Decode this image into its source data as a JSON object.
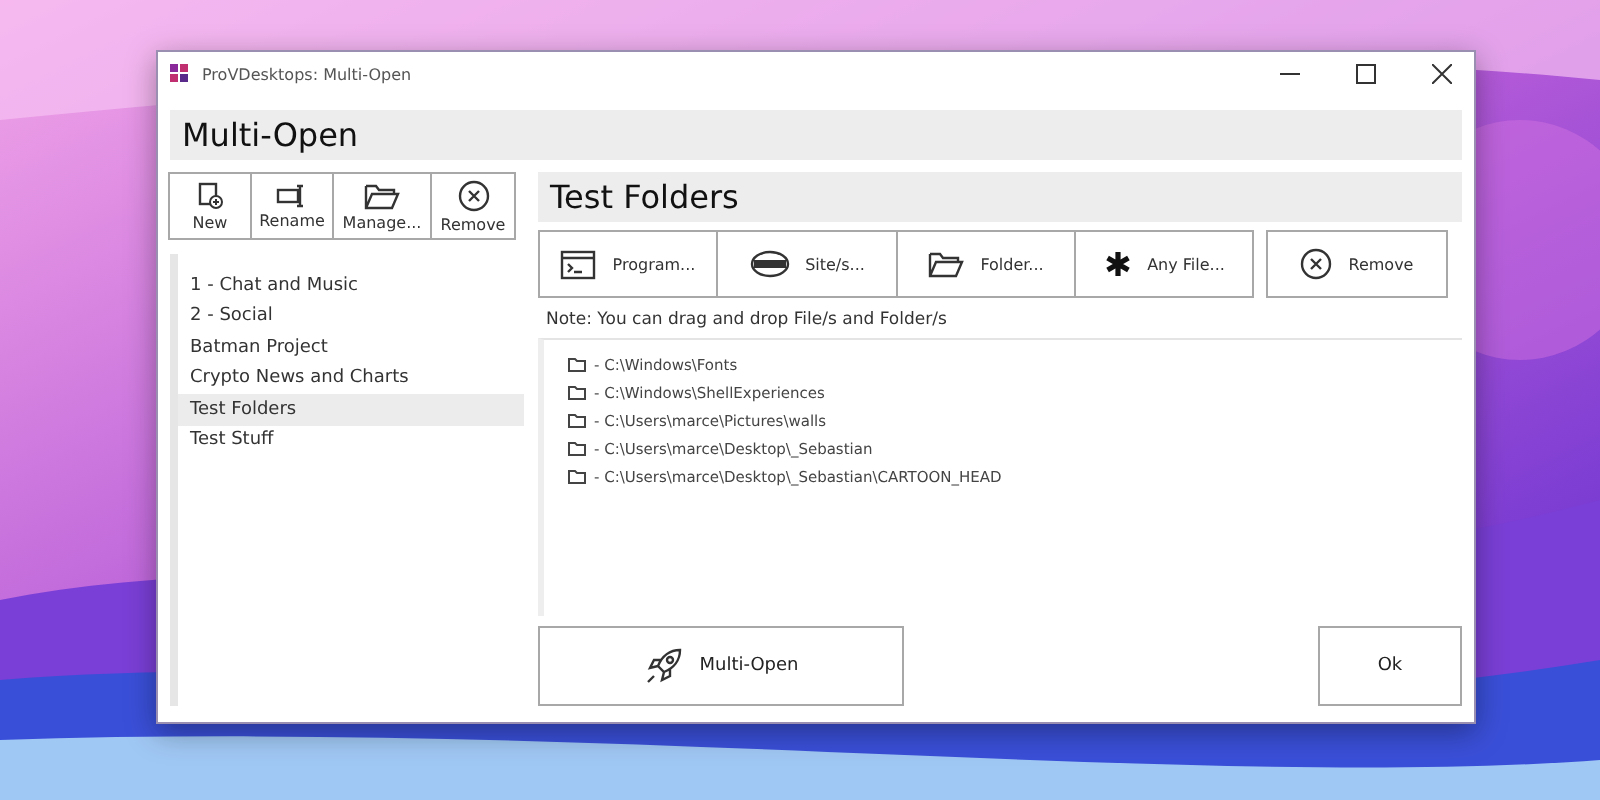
{
  "window": {
    "title": "ProVDesktops: Multi-Open"
  },
  "header": "Multi-Open",
  "group_toolbar": [
    {
      "kind": "new",
      "label": "New"
    },
    {
      "kind": "rename",
      "label": "Rename"
    },
    {
      "kind": "manage",
      "label": "Manage..."
    },
    {
      "kind": "remove",
      "label": "Remove"
    }
  ],
  "groups": [
    {
      "label": "1 - Chat and Music",
      "selected": false
    },
    {
      "label": "2 - Social",
      "selected": false
    },
    {
      "label": "Batman Project",
      "selected": false
    },
    {
      "label": "Crypto News and Charts",
      "selected": false
    },
    {
      "label": "Test Folders",
      "selected": true
    },
    {
      "label": "Test Stuff",
      "selected": false
    }
  ],
  "group_title": "Test Folders",
  "add_buttons": [
    {
      "kind": "program",
      "label": "Program..."
    },
    {
      "kind": "site",
      "label": "Site/s..."
    },
    {
      "kind": "folder",
      "label": "Folder..."
    },
    {
      "kind": "file",
      "label": "Any File..."
    },
    {
      "kind": "remove",
      "label": "Remove"
    }
  ],
  "note": "Note: You can drag and drop File/s and Folder/s",
  "items": [
    "- C:\\Windows\\Fonts",
    "- C:\\Windows\\ShellExperiences",
    "- C:\\Users\\marce\\Pictures\\walls",
    "- C:\\Users\\marce\\Desktop\\_Sebastian",
    "- C:\\Users\\marce\\Desktop\\_Sebastian\\CARTOON_HEAD"
  ],
  "multi_open_button": "Multi-Open",
  "ok_button": "Ok"
}
